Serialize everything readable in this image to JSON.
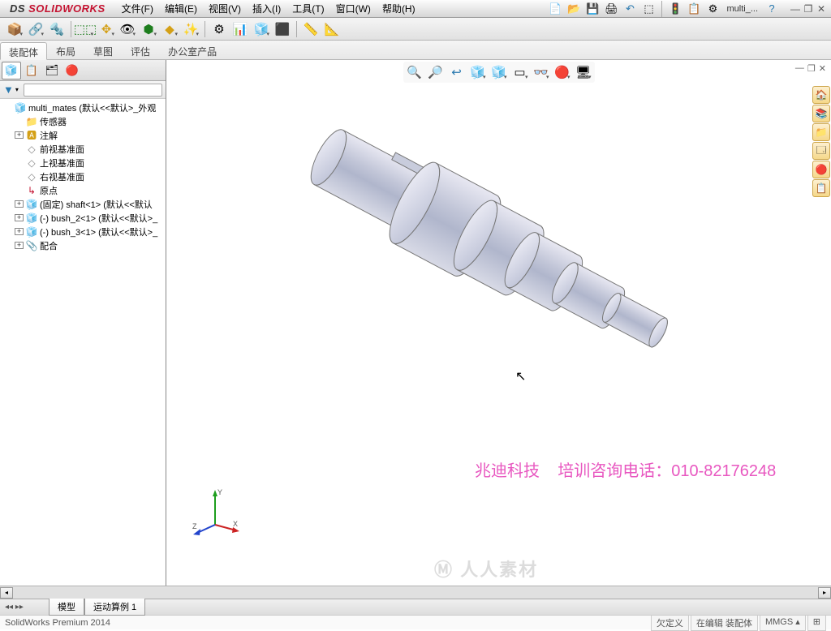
{
  "app": {
    "brand_prefix": "DS",
    "brand": "SOLIDWORKS"
  },
  "menu": {
    "file": "文件(F)",
    "edit": "编辑(E)",
    "view": "视图(V)",
    "insert": "插入(I)",
    "tools": "工具(T)",
    "window": "窗口(W)",
    "help": "帮助(H)"
  },
  "doc_tab": "multi_...",
  "ribbon": {
    "assembly": "装配体",
    "layout": "布局",
    "sketch": "草图",
    "evaluate": "评估",
    "office": "办公室产品"
  },
  "tree": {
    "root": "multi_mates  (默认<<默认>_外观",
    "sensors": "传感器",
    "annotations": "注解",
    "front": "前视基准面",
    "top": "上视基准面",
    "right": "右视基准面",
    "origin": "原点",
    "p1": "(固定) shaft<1> (默认<<默认",
    "p2": "(-) bush_2<1> (默认<<默认>_",
    "p3": "(-) bush_3<1> (默认<<默认>_",
    "mates": "配合"
  },
  "viewport": {
    "axes": {
      "x": "X",
      "y": "Y",
      "z": "Z"
    },
    "watermark_company": "兆迪科技",
    "watermark_phone": "培训咨询电话：010-82176248",
    "wm_logo": "人人素材"
  },
  "bottom_tabs": {
    "model": "模型",
    "motion": "运动算例 1"
  },
  "status": {
    "product": "SolidWorks Premium 2014",
    "underdefined": "欠定义",
    "editing": "在编辑 装配体",
    "units": "MMGS"
  },
  "help_glyph": "?"
}
